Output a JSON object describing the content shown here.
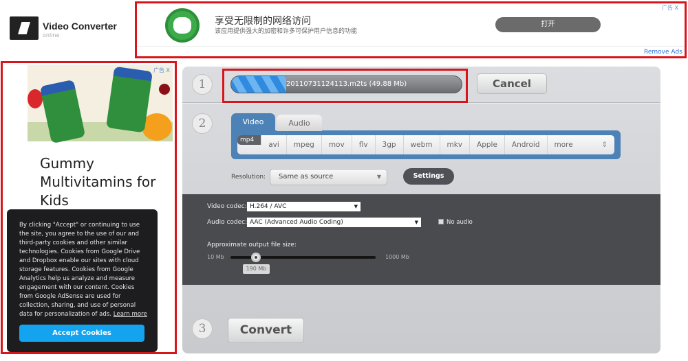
{
  "header": {
    "app_title": "Video Converter",
    "app_subtitle": "online"
  },
  "top_ad": {
    "title": "享受无限制的网络访问",
    "description": "该应用提供强大的加密和许多可保护用户信息的功能",
    "button": "打开",
    "ad_label": "广告",
    "close": "X",
    "remove_ads": "Remove Ads"
  },
  "side_ad": {
    "ad_label": "广告",
    "close": "X",
    "headline": "Gummy Multivitamins for Kids"
  },
  "cookie": {
    "text": "By clicking \"Accept\" or continuing to use the site, you agree to the use of our and third-party cookies and other similar technologies. Cookies from Google Drive and Dropbox enable our sites with cloud storage features. Cookies from Google Analytics help us analyze and measure engagement with our content. Cookies from Google AdSense are used for collection, sharing, and use of personal data for personalization of ads.",
    "learn_more": "Learn more",
    "accept": "Accept Cookies"
  },
  "step1": {
    "number": "1",
    "file": "20110731124113.m2ts (49.88 Mb)",
    "progress_percent": 24,
    "cancel": "Cancel"
  },
  "step2": {
    "number": "2",
    "tabs": [
      "Video",
      "Audio"
    ],
    "formats": [
      "mp4",
      "avi",
      "mpeg",
      "mov",
      "flv",
      "3gp",
      "webm",
      "mkv",
      "Apple",
      "Android",
      "more"
    ],
    "selected_format": "mp4",
    "resolution_label": "Resolution:",
    "resolution": "Same as source",
    "settings": "Settings"
  },
  "advanced": {
    "video_codec_label": "Video codec:",
    "video_codec": "H.264 / AVC",
    "audio_codec_label": "Audio codec:",
    "audio_codec": "AAC (Advanced Audio Coding)",
    "no_audio": "No audio",
    "no_audio_checked": false,
    "size_label": "Approximate output file size:",
    "min": "10 Mb",
    "max": "1000 Mb",
    "value": "190 Mb"
  },
  "step3": {
    "number": "3",
    "convert": "Convert"
  },
  "colors": {
    "accent": "#4d82b6",
    "ad_border": "#d9141b",
    "cookie_button": "#14a3ef"
  }
}
